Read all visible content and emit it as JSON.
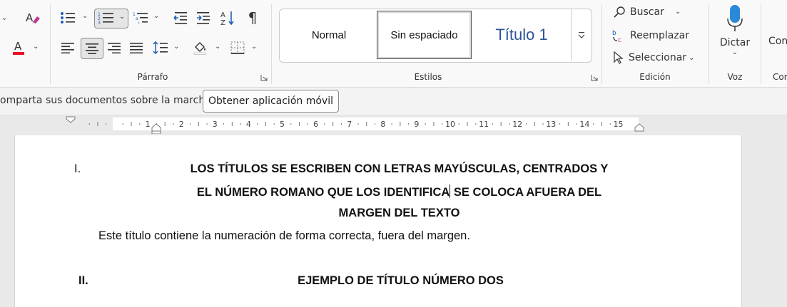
{
  "ribbon": {
    "groups": {
      "paragraph": "Párrafo",
      "styles": "Estilos",
      "editing": "Edición",
      "voice": "Voz",
      "comments_partial": "Con"
    },
    "styles_gallery": {
      "items": [
        "Normal",
        "Sin espaciado",
        "Título 1"
      ],
      "selected": "Sin espaciado",
      "heading_color": "#2f5496"
    },
    "editing": {
      "find": "Buscar",
      "replace": "Reemplazar",
      "select": "Seleccionar"
    },
    "voice": {
      "dictate": "Dictar"
    },
    "comments": {
      "label_partial": "Con"
    },
    "font_color_accent": "#e81123"
  },
  "infobar": {
    "message": "omparta sus documentos sobre la marcha",
    "button": "Obtener aplicación móvil"
  },
  "ruler": {
    "numbers": [
      "1",
      "2",
      "3",
      "4",
      "5",
      "6",
      "7",
      "8",
      "9",
      "10",
      "11",
      "12",
      "13",
      "14",
      "15"
    ]
  },
  "document": {
    "heading1": {
      "numeral": "I.",
      "line1": "LOS TÍTULOS SE ESCRIBEN CON LETRAS MAYÚSCULAS, CENTRADOS Y",
      "line2_before_cursor": "EL NÚMERO ROMANO QUE LOS IDENTIFICA",
      "line2_after_cursor": " SE COLOCA AFUERA DEL",
      "line3": "MARGEN DEL TEXTO"
    },
    "paragraph": "Este título contiene la numeración de forma correcta, fuera del margen.",
    "heading2": {
      "numeral": "II.",
      "text": "EJEMPLO DE TÍTULO NÚMERO DOS"
    }
  }
}
